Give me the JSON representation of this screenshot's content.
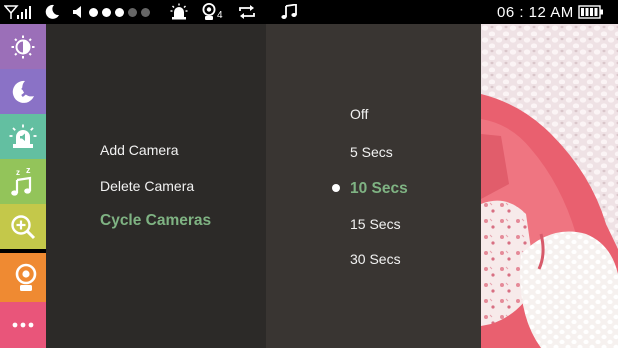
{
  "status_bar": {
    "icons": [
      "signal-icon",
      "moon-icon",
      "volume-icon",
      "alarm-light-icon",
      "camera-icon",
      "repeat-icon",
      "music-note-icon",
      "battery-icon"
    ],
    "volume_level": 3,
    "volume_max": 5,
    "camera_number": "4",
    "time": "06 : 12  AM"
  },
  "sidebar": {
    "items": [
      {
        "name": "brightness",
        "icon": "brightness-icon",
        "color": "#9b6fb8"
      },
      {
        "name": "night-light",
        "icon": "moon-icon",
        "color": "#8a72c6"
      },
      {
        "name": "alert",
        "icon": "alarm-light-icon",
        "color": "#63bfa1"
      },
      {
        "name": "lullaby",
        "icon": "music-zz-icon",
        "color": "#93c45a"
      },
      {
        "name": "zoom",
        "icon": "zoom-in-icon",
        "color": "#c4c84a"
      },
      {
        "name": "camera",
        "icon": "camera-icon",
        "color": "#ef8a32",
        "active": true
      },
      {
        "name": "more",
        "icon": "more-icon",
        "color": "#e9557a"
      }
    ]
  },
  "menu": {
    "items": [
      "Add Camera",
      "Delete Camera",
      "Cycle Cameras"
    ],
    "selected_index": 2
  },
  "options": {
    "items": [
      "Off",
      "5 Secs",
      "10 Secs",
      "15 Secs",
      "30 Secs"
    ],
    "selected_index": 2
  },
  "colors": {
    "selected_text": "#7fb383",
    "menu_bg": "#2c2a28",
    "options_bg": "#393532"
  }
}
